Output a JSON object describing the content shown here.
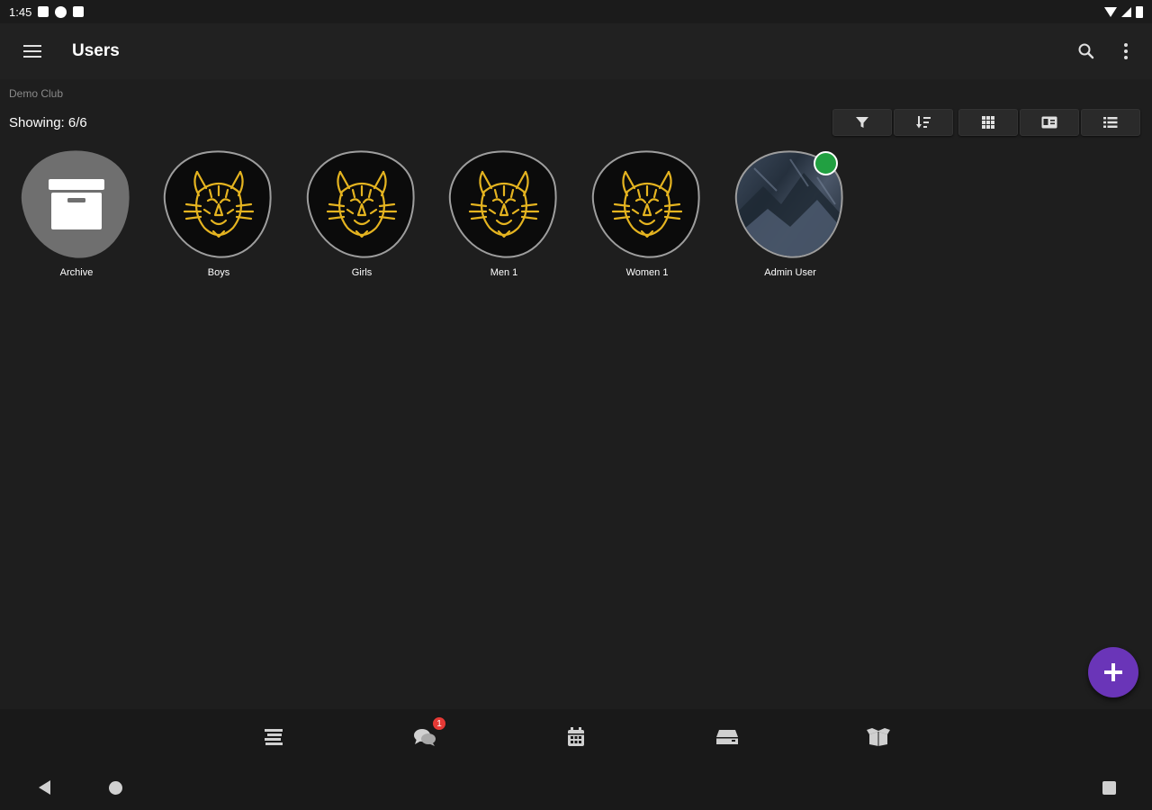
{
  "status_bar": {
    "time": "1:45"
  },
  "app_bar": {
    "title": "Users"
  },
  "header": {
    "club_name": "Demo Club",
    "showing": "Showing: 6/6"
  },
  "tiles": [
    {
      "label": "Archive",
      "kind": "archive"
    },
    {
      "label": "Boys",
      "kind": "team"
    },
    {
      "label": "Girls",
      "kind": "team"
    },
    {
      "label": "Men 1",
      "kind": "team"
    },
    {
      "label": "Women 1",
      "kind": "team"
    },
    {
      "label": "Admin User",
      "kind": "user",
      "online": true
    }
  ],
  "bottom_nav": {
    "items": [
      "list-icon",
      "chat-icon",
      "calendar-icon",
      "inbox-icon",
      "box-icon"
    ],
    "chat_badge": "1"
  },
  "colors": {
    "background": "#1e1e1e",
    "app_bar": "#212121",
    "fab": "#6a35b8",
    "online": "#21a041",
    "badge": "#e53935",
    "emblem": "#e5b420"
  }
}
